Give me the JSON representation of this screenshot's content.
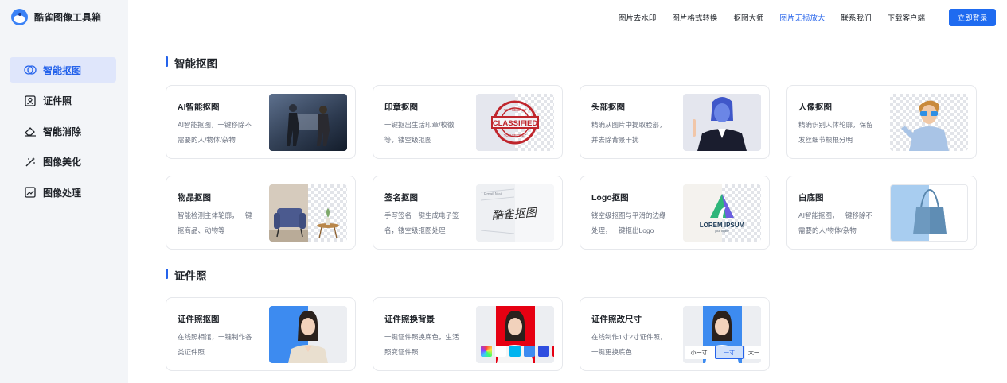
{
  "app": {
    "title": "酷雀图像工具箱",
    "logo_icon": "bird-logo-icon"
  },
  "sidebar": {
    "items": [
      {
        "label": "智能抠图",
        "icon": "lasso-icon",
        "active": true
      },
      {
        "label": "证件照",
        "icon": "id-photo-icon",
        "active": false
      },
      {
        "label": "智能消除",
        "icon": "eraser-icon",
        "active": false
      },
      {
        "label": "图像美化",
        "icon": "magic-wand-icon",
        "active": false
      },
      {
        "label": "图像处理",
        "icon": "image-icon",
        "active": false
      }
    ]
  },
  "header": {
    "links": [
      {
        "label": "图片去水印",
        "active": false
      },
      {
        "label": "图片格式转换",
        "active": false
      },
      {
        "label": "抠图大师",
        "active": false
      },
      {
        "label": "图片无损放大",
        "active": true
      },
      {
        "label": "联系我们",
        "active": false
      },
      {
        "label": "下载客户端",
        "active": false
      }
    ],
    "login_label": "立即登录"
  },
  "sections": [
    {
      "title": "智能抠图",
      "cards": [
        {
          "title": "AI智能抠图",
          "desc": "AI智能抠图，一键移除不需要的人/物体/杂物"
        },
        {
          "title": "印章抠图",
          "desc": "一键抠出生活印章/校徽等，镂空级抠图",
          "image_text": [
            "TOP SECRET",
            "CLASSIFIED",
            "TOP SECRET"
          ]
        },
        {
          "title": "头部抠图",
          "desc": "精确从图片中提取脸部，并去除背景干扰"
        },
        {
          "title": "人像抠图",
          "desc": "精确识别人体轮廓，保留发丝细节根根分明"
        },
        {
          "title": "物品抠图",
          "desc": "智能检测主体轮廓，一键抠商品、动物等"
        },
        {
          "title": "签名抠图",
          "desc": "手写签名一键生成电子签名，镂空级抠图处理",
          "image_text": [
            "Email Mail",
            "酷雀抠图"
          ]
        },
        {
          "title": "Logo抠图",
          "desc": "镂空级抠图与平滑的边缘处理，一键抠出Logo",
          "image_text": [
            "LOREM IPSUM",
            "your tagline"
          ]
        },
        {
          "title": "白底图",
          "desc": "AI智能抠图，一键移除不需要的人/物体/杂物"
        }
      ]
    },
    {
      "title": "证件照",
      "cards": [
        {
          "title": "证件照抠图",
          "desc": "在线照相馆，一键制作各类证件照"
        },
        {
          "title": "证件照换背景",
          "desc": "一键证件照换底色，生活照变证件照",
          "swatch_colors": [
            "#ffffff",
            "#00b4ef",
            "#3d8bf0",
            "#2f4ee0",
            "#e60012"
          ]
        },
        {
          "title": "证件照改尺寸",
          "desc": "在线制作1寸2寸证件照，一键更换底色",
          "size_tabs": [
            "小一寸",
            "一寸",
            "大一"
          ]
        }
      ]
    }
  ],
  "colors": {
    "accent": "#2563eb",
    "sidebar_bg": "#f3f5f8",
    "active_bg": "#dfe6fb"
  }
}
